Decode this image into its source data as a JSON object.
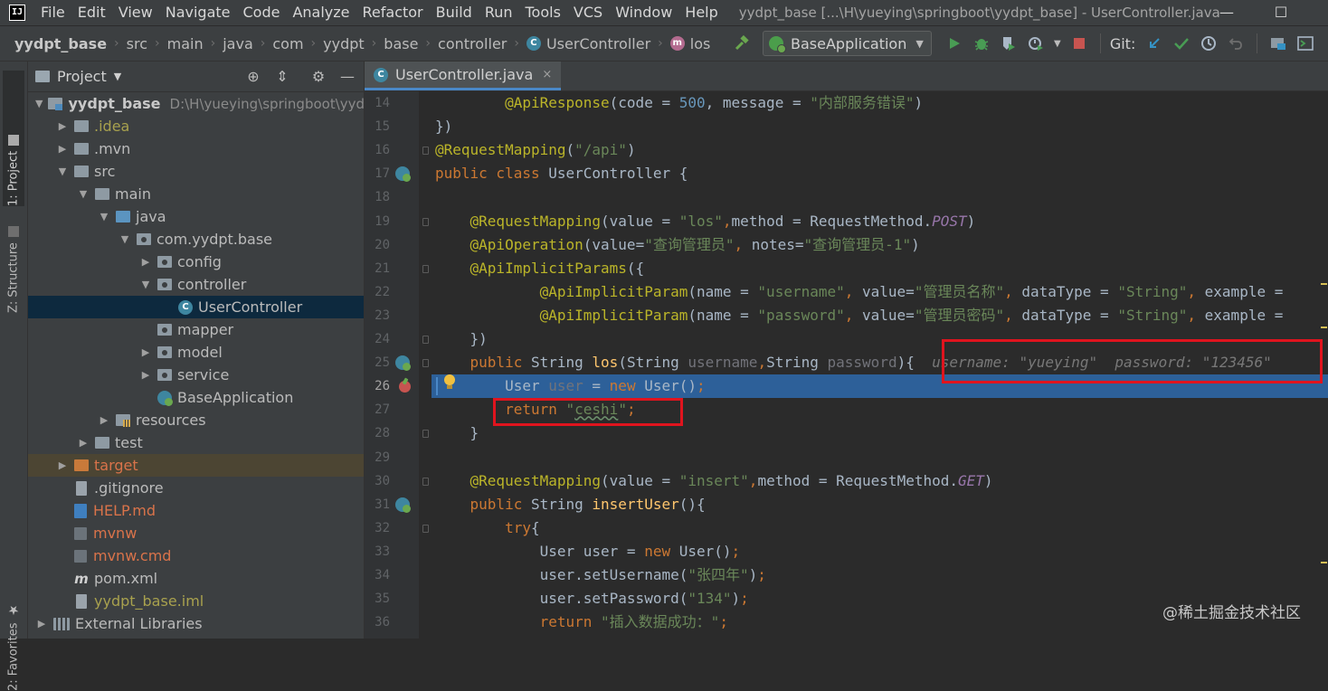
{
  "window": {
    "app_logo": "IJ",
    "menu": [
      "File",
      "Edit",
      "View",
      "Navigate",
      "Code",
      "Analyze",
      "Refactor",
      "Build",
      "Run",
      "Tools",
      "VCS",
      "Window",
      "Help"
    ],
    "title": "yydpt_base [...\\H\\yueying\\springboot\\yydpt_base] - UserController.java",
    "minimize_glyph": "—",
    "maximize_glyph": "☐"
  },
  "navbar": {
    "breadcrumb": [
      "yydpt_base",
      "src",
      "main",
      "java",
      "com",
      "yydpt",
      "base",
      "controller",
      "UserController",
      "los"
    ],
    "run_config": "BaseApplication",
    "git_label": "Git:",
    "icons": [
      "build-hammer-icon",
      "run-icon",
      "debug-icon",
      "coverage-icon",
      "profile-icon",
      "stop-icon",
      "git-update-icon",
      "git-commit-icon",
      "git-history-icon",
      "git-revert-icon",
      "project-structure-icon",
      "terminal-layout-icon"
    ]
  },
  "tool_stripe": {
    "project_tab": "1: Project",
    "structure_tab": "Z: Structure",
    "favorites_tab": "2: Favorites"
  },
  "project_panel": {
    "title": "Project",
    "tree": [
      {
        "label": "yydpt_base",
        "path": "D:\\H\\yueying\\springboot\\yydpt_base",
        "depth": 0,
        "arrow": "▼",
        "icon": "module"
      },
      {
        "label": ".idea",
        "depth": 1,
        "arrow": "▶",
        "icon": "folder",
        "color": "yellow"
      },
      {
        "label": ".mvn",
        "depth": 1,
        "arrow": "▶",
        "icon": "folder"
      },
      {
        "label": "src",
        "depth": 1,
        "arrow": "▼",
        "icon": "folder"
      },
      {
        "label": "main",
        "depth": 2,
        "arrow": "▼",
        "icon": "folder"
      },
      {
        "label": "java",
        "depth": 3,
        "arrow": "▼",
        "icon": "folder-blue"
      },
      {
        "label": "com.yydpt.base",
        "depth": 4,
        "arrow": "▼",
        "icon": "folder-pkg"
      },
      {
        "label": "config",
        "depth": 5,
        "arrow": "▶",
        "icon": "folder-pkg"
      },
      {
        "label": "controller",
        "depth": 5,
        "arrow": "▼",
        "icon": "folder-pkg"
      },
      {
        "label": "UserController",
        "depth": 6,
        "arrow": "",
        "icon": "class",
        "selected": true
      },
      {
        "label": "mapper",
        "depth": 5,
        "arrow": "",
        "icon": "folder-pkg"
      },
      {
        "label": "model",
        "depth": 5,
        "arrow": "▶",
        "icon": "folder-pkg"
      },
      {
        "label": "service",
        "depth": 5,
        "arrow": "▶",
        "icon": "folder-pkg"
      },
      {
        "label": "BaseApplication",
        "depth": 5,
        "arrow": "",
        "icon": "boot"
      },
      {
        "label": "resources",
        "depth": 3,
        "arrow": "▶",
        "icon": "res"
      },
      {
        "label": "test",
        "depth": 2,
        "arrow": "▶",
        "icon": "folder"
      },
      {
        "label": "target",
        "depth": 1,
        "arrow": "▶",
        "icon": "folder-orange",
        "color": "orange",
        "excluded": true
      },
      {
        "label": ".gitignore",
        "depth": 1,
        "arrow": "",
        "icon": "file"
      },
      {
        "label": "HELP.md",
        "depth": 1,
        "arrow": "",
        "icon": "file-md",
        "color": "red"
      },
      {
        "label": "mvnw",
        "depth": 1,
        "arrow": "",
        "icon": "term",
        "color": "red"
      },
      {
        "label": "mvnw.cmd",
        "depth": 1,
        "arrow": "",
        "icon": "term",
        "color": "red"
      },
      {
        "label": "pom.xml",
        "depth": 1,
        "arrow": "",
        "icon": "maven"
      },
      {
        "label": "yydpt_base.iml",
        "depth": 1,
        "arrow": "",
        "icon": "iml",
        "color": "yellow"
      },
      {
        "label": "External Libraries",
        "depth": 0,
        "arrow": "▶",
        "icon": "libs"
      }
    ]
  },
  "editor": {
    "tab_label": "UserController.java",
    "tab_close": "×",
    "lines": [
      {
        "n": "14",
        "t": [
          [
            "",
            "        "
          ],
          [
            "ann",
            "@ApiResponse"
          ],
          [
            "",
            "(code = "
          ],
          [
            "num",
            "500"
          ],
          [
            "",
            ", message = "
          ],
          [
            "str",
            "\"内部服务错误\""
          ],
          [
            "",
            ")"
          ]
        ]
      },
      {
        "n": "15",
        "t": [
          [
            "",
            "})"
          ]
        ]
      },
      {
        "n": "16",
        "t": [
          [
            "ann",
            "@RequestMapping"
          ],
          [
            "",
            "("
          ],
          [
            "str",
            "\"/api\""
          ],
          [
            "",
            ")"
          ]
        ]
      },
      {
        "n": "17",
        "t": [
          [
            "kw",
            "public class "
          ],
          [
            "",
            "UserController {"
          ]
        ]
      },
      {
        "n": "18",
        "t": []
      },
      {
        "n": "19",
        "t": [
          [
            "",
            "    "
          ],
          [
            "ann",
            "@RequestMapping"
          ],
          [
            "",
            "(value = "
          ],
          [
            "str",
            "\"los\""
          ],
          [
            "kw",
            ","
          ],
          [
            "",
            "method = RequestMethod."
          ],
          [
            "enumc",
            "POST"
          ],
          [
            "",
            ")"
          ]
        ]
      },
      {
        "n": "20",
        "t": [
          [
            "",
            "    "
          ],
          [
            "ann",
            "@ApiOperation"
          ],
          [
            "",
            "(value="
          ],
          [
            "str",
            "\"查询管理员\""
          ],
          [
            "kw",
            ", "
          ],
          [
            "",
            "notes="
          ],
          [
            "str",
            "\"查询管理员-1\""
          ],
          [
            "",
            ")"
          ]
        ]
      },
      {
        "n": "21",
        "t": [
          [
            "",
            "    "
          ],
          [
            "ann",
            "@ApiImplicitParams"
          ],
          [
            "",
            "({"
          ]
        ]
      },
      {
        "n": "22",
        "t": [
          [
            "",
            "            "
          ],
          [
            "ann",
            "@ApiImplicitParam"
          ],
          [
            "",
            "(name = "
          ],
          [
            "str",
            "\"username\""
          ],
          [
            "kw",
            ", "
          ],
          [
            "",
            "value="
          ],
          [
            "str",
            "\"管理员名称\""
          ],
          [
            "kw",
            ", "
          ],
          [
            "",
            "dataType = "
          ],
          [
            "str",
            "\"String\""
          ],
          [
            "kw",
            ", "
          ],
          [
            "",
            "example = "
          ]
        ]
      },
      {
        "n": "23",
        "t": [
          [
            "",
            "            "
          ],
          [
            "ann",
            "@ApiImplicitParam"
          ],
          [
            "",
            "(name = "
          ],
          [
            "str",
            "\"password\""
          ],
          [
            "kw",
            ", "
          ],
          [
            "",
            "value="
          ],
          [
            "str",
            "\"管理员密码\""
          ],
          [
            "kw",
            ", "
          ],
          [
            "",
            "dataType = "
          ],
          [
            "str",
            "\"String\""
          ],
          [
            "kw",
            ", "
          ],
          [
            "",
            "example = "
          ]
        ]
      },
      {
        "n": "24",
        "t": [
          [
            "",
            "    })"
          ]
        ]
      },
      {
        "n": "25",
        "t": [
          [
            "",
            "    "
          ],
          [
            "kw",
            "public "
          ],
          [
            "",
            "String "
          ],
          [
            "fn",
            "los"
          ],
          [
            "",
            "(String "
          ],
          [
            "param-unused",
            "username"
          ],
          [
            "kw",
            ","
          ],
          [
            "",
            "String "
          ],
          [
            "param-unused",
            "password"
          ],
          [
            "",
            "){  "
          ],
          [
            "inlay",
            "username: \"yueying\"  password: \"123456\""
          ]
        ]
      },
      {
        "n": "26",
        "t": [
          [
            "",
            "        User "
          ],
          [
            "param-unused",
            "user"
          ],
          [
            "",
            " = "
          ],
          [
            "kw",
            "new "
          ],
          [
            "",
            "User()"
          ],
          [
            "kw",
            ";"
          ]
        ],
        "exec": true
      },
      {
        "n": "27",
        "t": [
          [
            "",
            "        "
          ],
          [
            "kw",
            "return "
          ],
          [
            "str",
            "\""
          ],
          [
            "str typo",
            "ceshi"
          ],
          [
            "str",
            "\""
          ],
          [
            "kw",
            ";"
          ]
        ]
      },
      {
        "n": "28",
        "t": [
          [
            "",
            "    }"
          ]
        ]
      },
      {
        "n": "29",
        "t": []
      },
      {
        "n": "30",
        "t": [
          [
            "",
            "    "
          ],
          [
            "ann",
            "@RequestMapping"
          ],
          [
            "",
            "(value = "
          ],
          [
            "str",
            "\"insert\""
          ],
          [
            "kw",
            ","
          ],
          [
            "",
            "method = RequestMethod."
          ],
          [
            "enumc",
            "GET"
          ],
          [
            "",
            ")"
          ]
        ]
      },
      {
        "n": "31",
        "t": [
          [
            "",
            "    "
          ],
          [
            "kw",
            "public "
          ],
          [
            "",
            "String "
          ],
          [
            "fn",
            "insertUser"
          ],
          [
            "",
            "(){"
          ]
        ]
      },
      {
        "n": "32",
        "t": [
          [
            "",
            "        "
          ],
          [
            "kw",
            "try"
          ],
          [
            "",
            "{"
          ]
        ]
      },
      {
        "n": "33",
        "t": [
          [
            "",
            "            User user = "
          ],
          [
            "kw",
            "new "
          ],
          [
            "",
            "User()"
          ],
          [
            "kw",
            ";"
          ]
        ]
      },
      {
        "n": "34",
        "t": [
          [
            "",
            "            user.setUsername("
          ],
          [
            "str",
            "\"张四年\""
          ],
          [
            "",
            ")"
          ],
          [
            "kw",
            ";"
          ]
        ]
      },
      {
        "n": "35",
        "t": [
          [
            "",
            "            user.setPassword("
          ],
          [
            "str",
            "\"134\""
          ],
          [
            "",
            ")"
          ],
          [
            "kw",
            ";"
          ]
        ]
      },
      {
        "n": "36",
        "t": [
          [
            "",
            "            "
          ],
          [
            "kw",
            "return "
          ],
          [
            "str",
            "\"插入数据成功：\""
          ],
          [
            "kw",
            ";"
          ]
        ]
      }
    ]
  },
  "watermark": "@稀土掘金技术社区"
}
